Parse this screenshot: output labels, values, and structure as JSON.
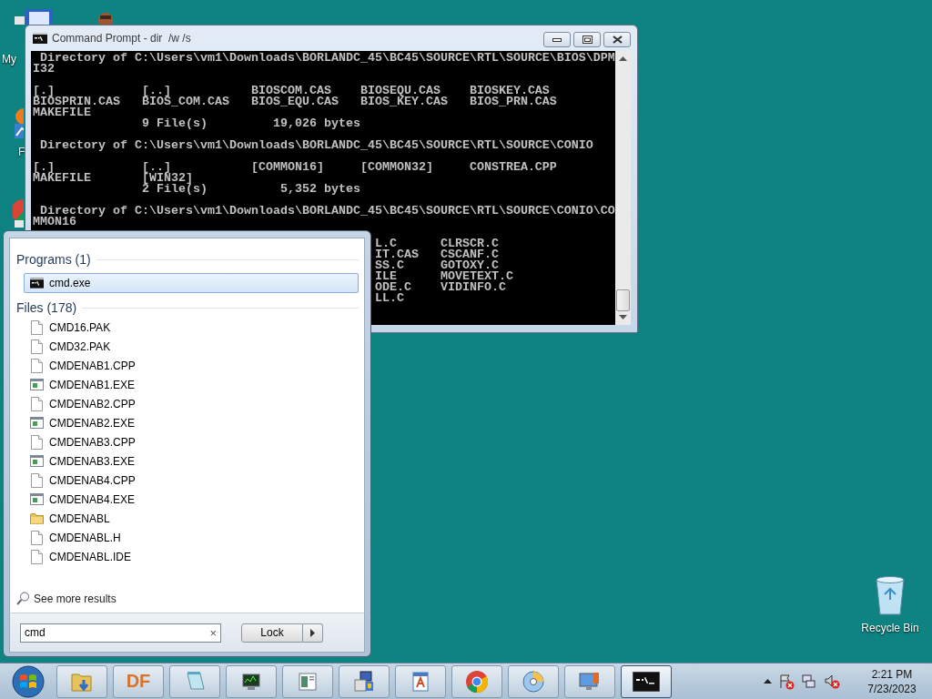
{
  "desktop_icons": [
    {
      "kind": "computer",
      "label": "My"
    },
    {
      "kind": "person"
    },
    {
      "kind": "shortcut",
      "label": "F"
    },
    {
      "kind": "chrome"
    },
    {
      "kind": "recycle",
      "label": "Recycle Bin"
    }
  ],
  "console_window": {
    "title": "Command Prompt - dir  /w /s",
    "blocks": [
      [
        " Directory of C:\\Users\\vm1\\Downloads\\BORLANDC_45\\BC45\\SOURCE\\RTL\\SOURCE\\BIOS\\DPM",
        "I32"
      ],
      [
        "[.]            [..]           BIOSCOM.CAS    BIOSEQU.CAS    BIOSKEY.CAS",
        "BIOSPRIN.CAS   BIOS_COM.CAS   BIOS_EQU.CAS   BIOS_KEY.CAS   BIOS_PRN.CAS",
        "MAKEFILE",
        "               9 File(s)         19,026 bytes"
      ],
      [
        " Directory of C:\\Users\\vm1\\Downloads\\BORLANDC_45\\BC45\\SOURCE\\RTL\\SOURCE\\CONIO"
      ],
      [
        "[.]            [..]           [COMMON16]     [COMMON32]     CONSTREA.CPP",
        "MAKEFILE       [WIN32]",
        "               2 File(s)          5,352 bytes"
      ],
      [
        " Directory of C:\\Users\\vm1\\Downloads\\BORLANDC_45\\BC45\\SOURCE\\RTL\\SOURCE\\CONIO\\CO",
        "MMON16"
      ],
      [
        "                                               L.C      CLRSCR.C",
        "                                               IT.CAS   CSCANF.C",
        "                                               SS.C     GOTOXY.C",
        "                                               ILE      MOVETEXT.C",
        "                                               ODE.C    VIDINFO.C",
        "                                               LL.C"
      ]
    ]
  },
  "search_menu": {
    "groups": [
      {
        "heading": "Programs (1)",
        "items": [
          {
            "name": "cmd.exe",
            "kind": "console",
            "selected": true
          }
        ]
      },
      {
        "heading": "Files (178)",
        "items": [
          {
            "name": "CMD16.PAK",
            "kind": "doc",
            "selected": false
          },
          {
            "name": "CMD32.PAK",
            "kind": "doc",
            "selected": false
          },
          {
            "name": "CMDENAB1.CPP",
            "kind": "doc",
            "selected": false
          },
          {
            "name": "CMDENAB1.EXE",
            "kind": "exe",
            "selected": false
          },
          {
            "name": "CMDENAB2.CPP",
            "kind": "doc",
            "selected": false
          },
          {
            "name": "CMDENAB2.EXE",
            "kind": "exe",
            "selected": false
          },
          {
            "name": "CMDENAB3.CPP",
            "kind": "doc",
            "selected": false
          },
          {
            "name": "CMDENAB3.EXE",
            "kind": "exe",
            "selected": false
          },
          {
            "name": "CMDENAB4.CPP",
            "kind": "doc",
            "selected": false
          },
          {
            "name": "CMDENAB4.EXE",
            "kind": "exe",
            "selected": false
          },
          {
            "name": "CMDENABL",
            "kind": "folder",
            "selected": false
          },
          {
            "name": "CMDENABL.H",
            "kind": "doc",
            "selected": false
          },
          {
            "name": "CMDENABL.IDE",
            "kind": "doc",
            "selected": false
          }
        ]
      }
    ],
    "see_more": "See more results",
    "search": {
      "value": "cmd",
      "clear": "×"
    },
    "power_button": {
      "label": "Lock"
    }
  },
  "taskbar": {
    "buttons": [
      {
        "kind": "start"
      },
      {
        "kind": "folder"
      },
      {
        "kind": "df",
        "label": "DF"
      },
      {
        "kind": "notepad"
      },
      {
        "kind": "monitor"
      },
      {
        "kind": "window"
      },
      {
        "kind": "setup"
      },
      {
        "kind": "wordpad"
      },
      {
        "kind": "chrome"
      },
      {
        "kind": "disc"
      },
      {
        "kind": "remote"
      },
      {
        "kind": "console",
        "selected": true
      }
    ],
    "tray": {
      "icons": [
        {
          "kind": "flag"
        },
        {
          "kind": "network"
        },
        {
          "kind": "speaker"
        }
      ],
      "time": "2:21 PM",
      "date": "7/23/2023"
    }
  }
}
